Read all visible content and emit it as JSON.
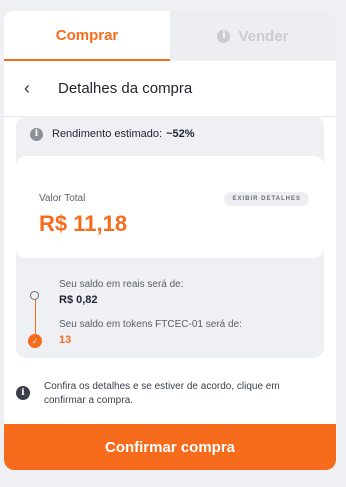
{
  "tabs": {
    "buy": "Comprar",
    "sell": "Vender"
  },
  "header": {
    "back": "‹",
    "title": "Detalhes da compra"
  },
  "yield": {
    "label": "Rendimento estimado:",
    "value": "~52%"
  },
  "total": {
    "label": "Valor Total",
    "value": "R$ 11,18",
    "details_button": "EXIBIR DETALHES"
  },
  "timeline": {
    "reais_label": "Seu saldo em reais será de:",
    "reais_value": "R$ 0,82",
    "tokens_label": "Seu saldo em tokens FTCEC-01 será de:",
    "tokens_value": "13"
  },
  "notice": "Confira os detalhes e se estiver de acordo, clique em confirmar a compra.",
  "confirm_button": "Confirmar compra",
  "icons": {
    "info": "info-icon",
    "back": "chevron-left-icon",
    "check": "check-icon"
  },
  "colors": {
    "accent": "#f76b1c"
  }
}
